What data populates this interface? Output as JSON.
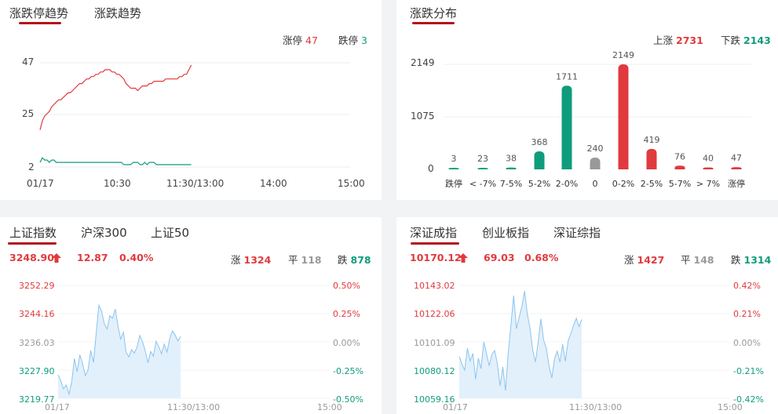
{
  "trend": {
    "tabs": [
      "涨跌停趋势",
      "涨跌趋势"
    ],
    "limit_up_label": "涨停",
    "limit_up": "47",
    "limit_down_label": "跌停",
    "limit_down": "3",
    "y_ticks": [
      "47",
      "25",
      "2"
    ],
    "x_ticks": [
      "01/17",
      "10:30",
      "11:30/13:00",
      "14:00",
      "15:00"
    ]
  },
  "dist": {
    "tab": "涨跌分布",
    "up_label": "上涨",
    "up": "2731",
    "down_label": "下跌",
    "down": "2143",
    "y_ticks": [
      "2149",
      "1075",
      "0"
    ]
  },
  "sh": {
    "tabs": [
      "上证指数",
      "沪深300",
      "上证50"
    ],
    "price": "3248.90",
    "change": "12.87",
    "pct": "0.40%",
    "up_label": "涨",
    "up": "1324",
    "flat_label": "平",
    "flat": "118",
    "down_label": "跌",
    "down": "878",
    "y_left": [
      "3252.29",
      "3244.16",
      "3236.03",
      "3227.90",
      "3219.77"
    ],
    "y_right": [
      "0.50%",
      "0.25%",
      "0.00%",
      "-0.25%",
      "-0.50%"
    ],
    "x_ticks": [
      "01/17",
      "11:30/13:00",
      "15:00"
    ]
  },
  "sz": {
    "tabs": [
      "深证成指",
      "创业板指",
      "深证综指"
    ],
    "price": "10170.12",
    "change": "69.03",
    "pct": "0.68%",
    "up_label": "涨",
    "up": "1427",
    "flat_label": "平",
    "flat": "148",
    "down_label": "跌",
    "down": "1314",
    "y_left": [
      "10143.02",
      "10122.06",
      "10101.09",
      "10080.12",
      "10059.16"
    ],
    "y_right": [
      "0.42%",
      "0.21%",
      "0.00%",
      "-0.21%",
      "-0.42%"
    ],
    "x_ticks": [
      "01/17",
      "11:30/13:00",
      "15:00"
    ]
  },
  "chart_data": [
    {
      "type": "line",
      "title": "涨跌停趋势",
      "x_ticks": [
        "01/17",
        "10:30",
        "11:30/13:00",
        "14:00",
        "15:00"
      ],
      "ylim": [
        2,
        47
      ],
      "series": [
        {
          "name": "涨停",
          "color": "#e03a3e",
          "x": [
            0,
            3,
            6,
            9,
            12,
            15,
            18,
            21,
            24,
            27,
            30,
            33,
            36,
            39,
            42,
            45,
            48,
            51,
            54,
            57,
            60,
            63,
            66,
            69,
            72,
            75,
            78,
            81,
            84,
            87,
            90,
            93,
            96,
            99,
            102,
            105,
            108,
            111,
            114,
            117,
            120,
            123,
            126,
            129,
            132,
            135,
            138,
            141,
            144,
            147,
            150,
            153,
            156,
            159,
            162,
            165,
            168,
            171,
            174,
            177,
            180,
            183,
            186,
            189,
            192,
            195
          ],
          "values": [
            18,
            22,
            24,
            25,
            26,
            28,
            29,
            30,
            31,
            31,
            32,
            33,
            34,
            34,
            35,
            36,
            37,
            38,
            38,
            39,
            40,
            40,
            41,
            41,
            42,
            42,
            43,
            43,
            44,
            44,
            44,
            43,
            43,
            42,
            42,
            41,
            40,
            38,
            37,
            36,
            36,
            36,
            35,
            36,
            37,
            37,
            37,
            38,
            38,
            39,
            39,
            39,
            39,
            39,
            40,
            40,
            40,
            40,
            40,
            40,
            41,
            41,
            42,
            42,
            44,
            46
          ]
        },
        {
          "name": "跌停",
          "color": "#0f9c7c",
          "x": [
            0,
            3,
            6,
            9,
            12,
            15,
            18,
            21,
            24,
            27,
            30,
            33,
            36,
            39,
            42,
            45,
            48,
            51,
            54,
            57,
            60,
            63,
            66,
            69,
            72,
            75,
            78,
            81,
            84,
            87,
            90,
            93,
            96,
            99,
            102,
            105,
            108,
            111,
            114,
            117,
            120,
            123,
            126,
            129,
            132,
            135,
            138,
            141,
            144,
            147,
            150,
            153,
            156,
            159,
            162,
            165,
            168,
            171,
            174,
            177,
            180,
            183,
            186,
            189,
            192,
            195
          ],
          "values": [
            4,
            6,
            5,
            5,
            4,
            5,
            5,
            4,
            4,
            4,
            4,
            4,
            4,
            4,
            4,
            4,
            4,
            4,
            4,
            4,
            4,
            4,
            4,
            4,
            4,
            4,
            4,
            4,
            4,
            4,
            4,
            4,
            4,
            4,
            4,
            4,
            3,
            3,
            3,
            3,
            4,
            4,
            4,
            3,
            3,
            4,
            3,
            4,
            4,
            4,
            3,
            3,
            3,
            3,
            3,
            3,
            3,
            3,
            3,
            3,
            3,
            3,
            3,
            3,
            3,
            3
          ]
        }
      ]
    },
    {
      "type": "bar",
      "title": "涨跌分布",
      "categories": [
        "跌停",
        "< -7%",
        "7-5%",
        "5-2%",
        "2-0%",
        "0",
        "0-2%",
        "2-5%",
        "5-7%",
        "> 7%",
        "涨停"
      ],
      "values": [
        3,
        23,
        38,
        368,
        1711,
        240,
        2149,
        419,
        76,
        40,
        47
      ],
      "colors": [
        "#0f9c7c",
        "#0f9c7c",
        "#0f9c7c",
        "#0f9c7c",
        "#0f9c7c",
        "#999999",
        "#e03a3e",
        "#e03a3e",
        "#e03a3e",
        "#e03a3e",
        "#e03a3e"
      ],
      "ylim": [
        0,
        2149
      ]
    },
    {
      "type": "area",
      "title": "上证指数",
      "ylim": [
        3219.77,
        3252.29
      ],
      "x_ticks": [
        "01/17",
        "11:30/13:00",
        "15:00"
      ],
      "values": [
        3226.5,
        3224.8,
        3222.5,
        3223.6,
        3221.0,
        3224.5,
        3231.2,
        3227.4,
        3232.3,
        3229.8,
        3226.3,
        3227.9,
        3233.6,
        3230.1,
        3238.5,
        3246.6,
        3244.8,
        3241.2,
        3239.7,
        3243.6,
        3242.8,
        3245.5,
        3240.6,
        3236.8,
        3238.8,
        3233.0,
        3231.7,
        3233.8,
        3232.8,
        3234.5,
        3237.9,
        3236.1,
        3233.6,
        3230.0,
        3233.3,
        3231.9,
        3236.2,
        3234.6,
        3232.6,
        3235.4,
        3233.1,
        3236.9,
        3239.2,
        3238.0,
        3236.3,
        3237.6
      ]
    },
    {
      "type": "area",
      "title": "深证成指",
      "ylim": [
        10059.16,
        10143.02
      ],
      "x_ticks": [
        "01/17",
        "11:30/13:00",
        "15:00"
      ],
      "values": [
        10090.2,
        10084.5,
        10080.1,
        10096.4,
        10086.8,
        10092.4,
        10073.5,
        10089.0,
        10081.2,
        10101.0,
        10092.5,
        10083.4,
        10091.8,
        10094.6,
        10085.2,
        10068.3,
        10082.4,
        10064.9,
        10093.0,
        10114.0,
        10135.5,
        10110.9,
        10119.3,
        10127.1,
        10138.9,
        10121.7,
        10111.4,
        10094.8,
        10086.1,
        10101.0,
        10118.2,
        10102.4,
        10096.3,
        10083.1,
        10074.3,
        10088.4,
        10094.2,
        10086.0,
        10099.3,
        10086.7,
        10101.9,
        10107.2,
        10113.4,
        10118.6,
        10112.4,
        10117.7
      ]
    }
  ]
}
